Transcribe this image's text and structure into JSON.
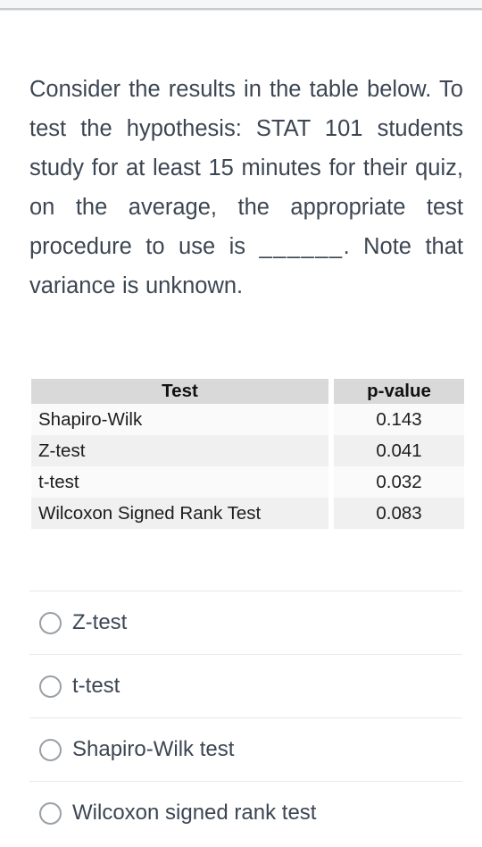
{
  "question": {
    "text_before_blank": "Consider the results in the table below. To test the hypothesis: STAT 101 students study for at least 15 minutes for their quiz, on the average, the appropriate test procedure to use is ",
    "blank": "______",
    "text_after_blank": ". Note that variance is unknown."
  },
  "table": {
    "headers": [
      "Test",
      "p-value"
    ],
    "rows": [
      {
        "test": "Shapiro-Wilk",
        "p_value": "0.143"
      },
      {
        "test": "Z-test",
        "p_value": "0.041"
      },
      {
        "test": "t-test",
        "p_value": "0.032"
      },
      {
        "test": "Wilcoxon Signed Rank Test",
        "p_value": "0.083"
      }
    ]
  },
  "options": [
    {
      "label": "Z-test",
      "selected": false
    },
    {
      "label": "t-test",
      "selected": false
    },
    {
      "label": "Shapiro-Wilk test",
      "selected": false
    },
    {
      "label": "Wilcoxon signed rank test",
      "selected": false
    }
  ],
  "colors": {
    "text": "#3c4653",
    "table_header_bg": "#d9d9d9",
    "row_light": "#fafafa",
    "row_dark": "#f0f0f0",
    "divider": "#e9eaec",
    "radio_border": "#9aa0a6"
  }
}
